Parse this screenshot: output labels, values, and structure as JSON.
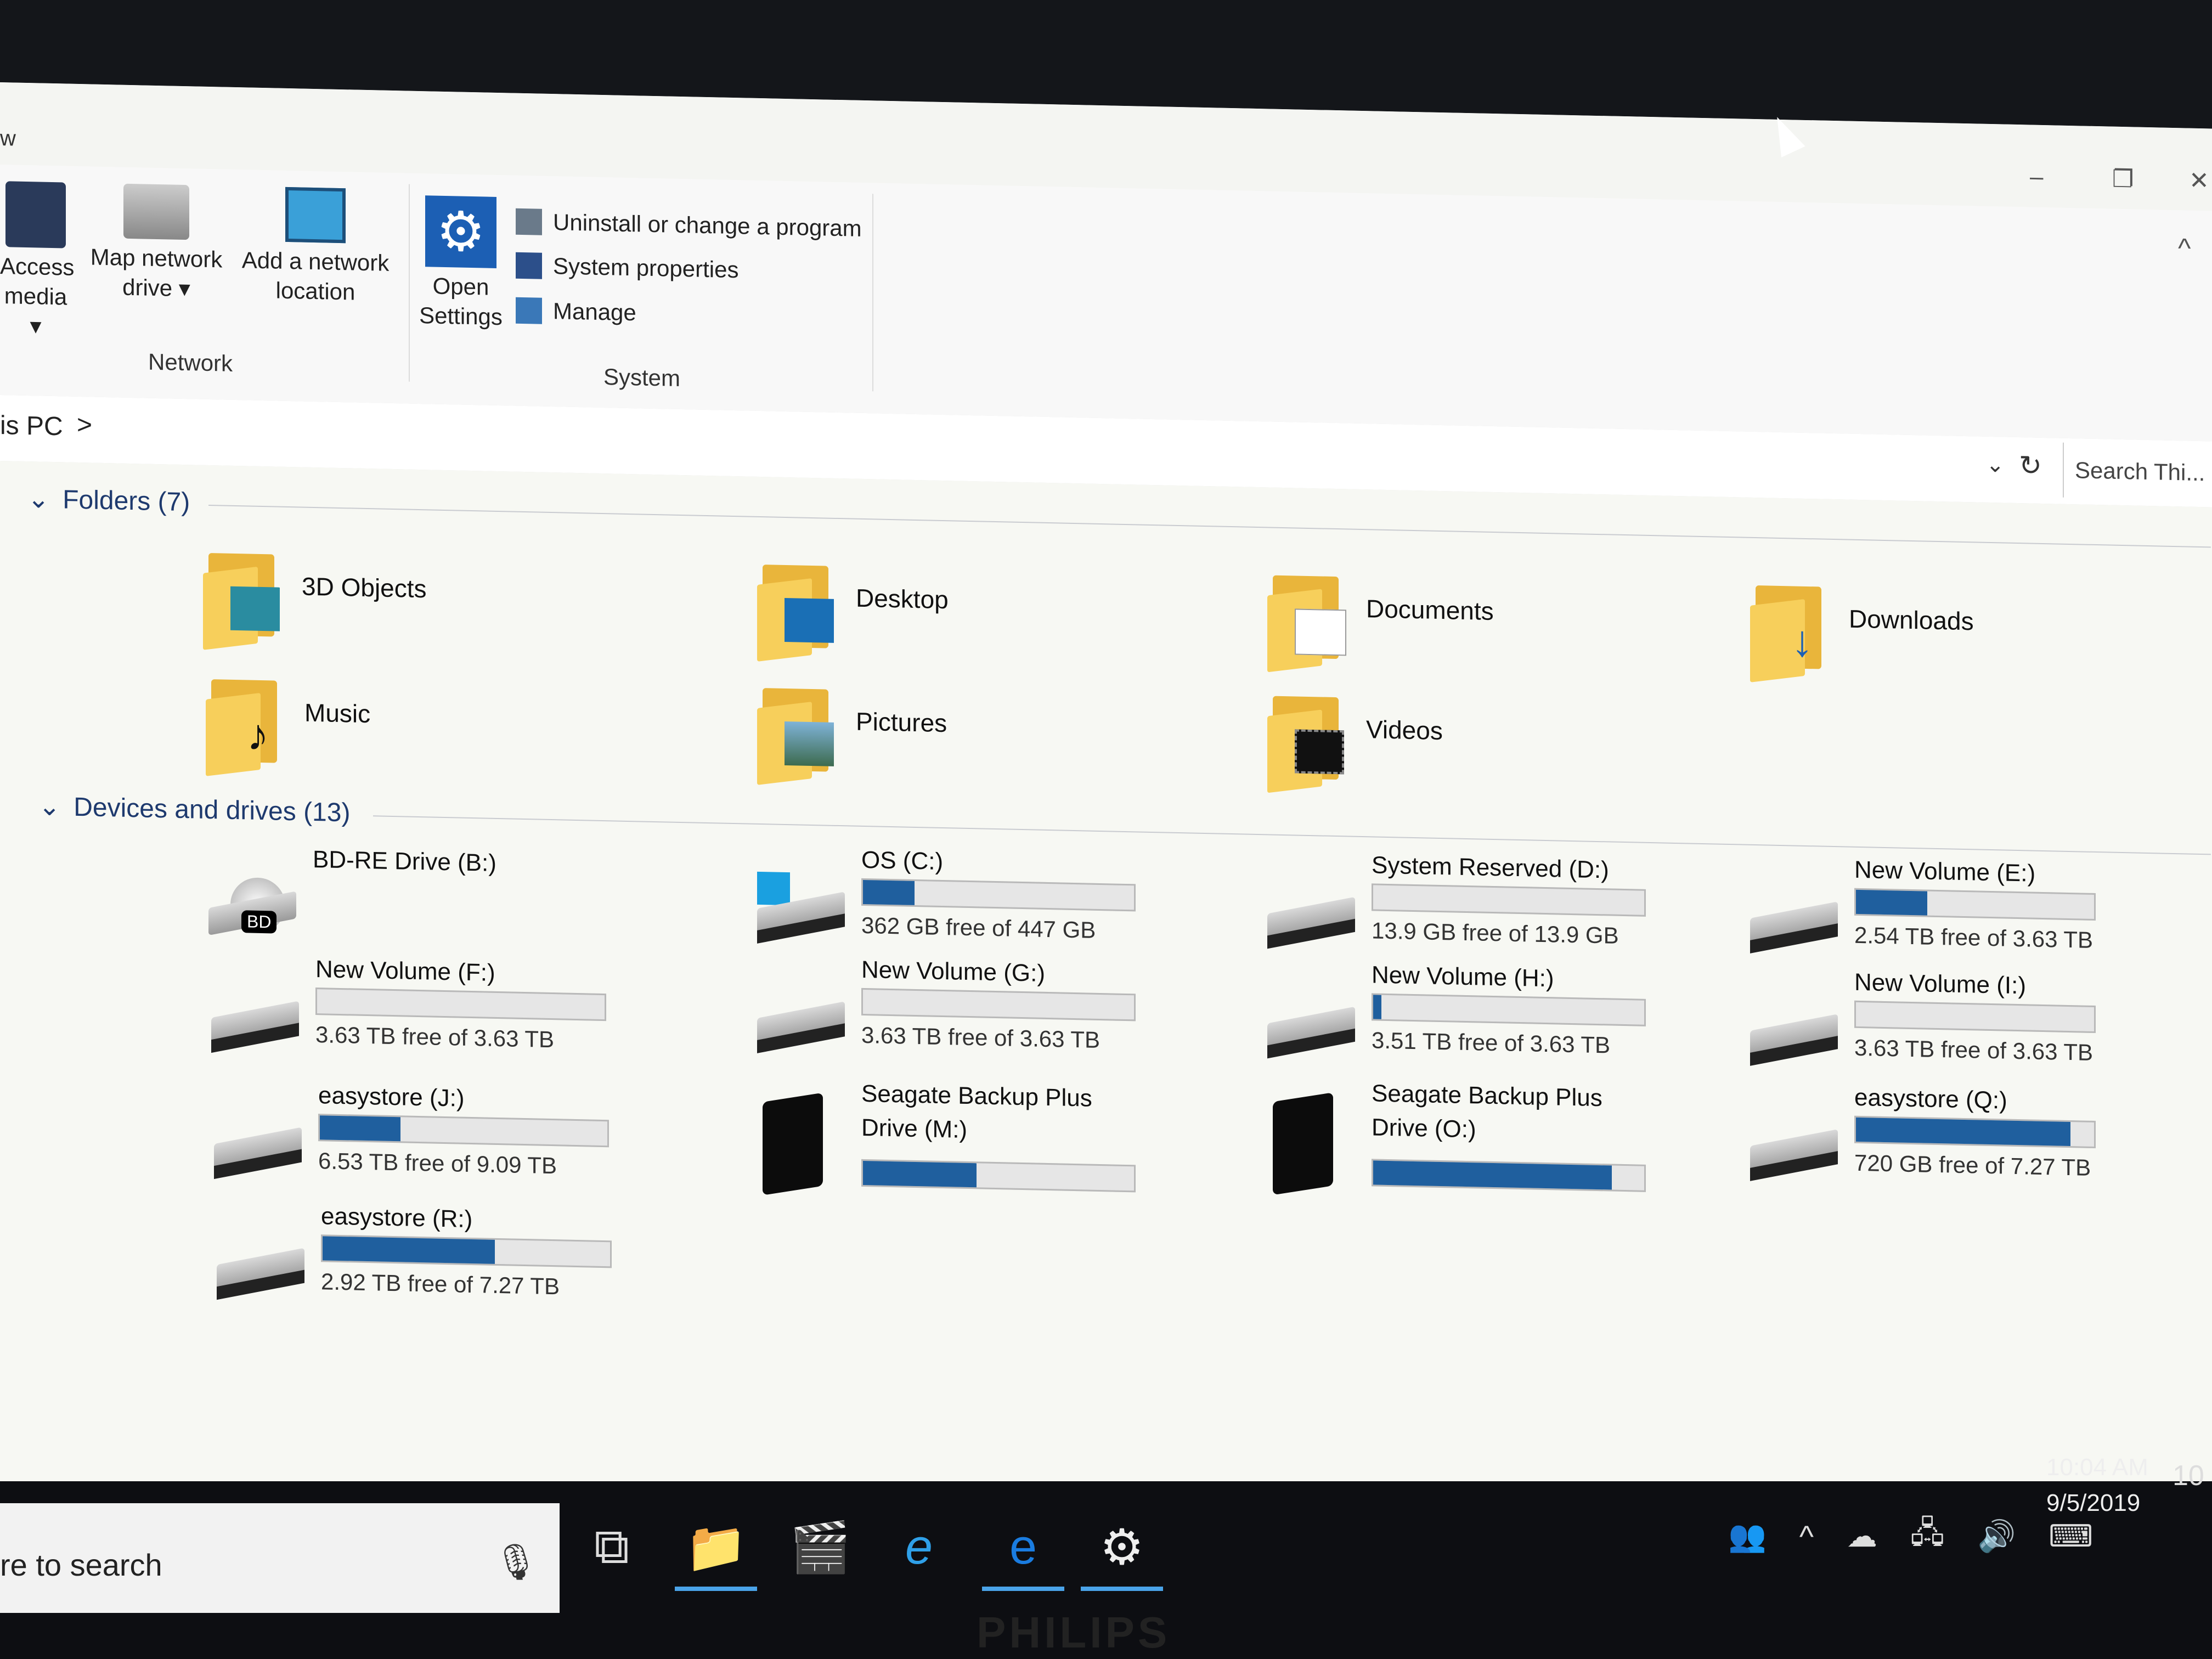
{
  "window": {
    "title_fragment": "w",
    "controls": [
      "–",
      "❐",
      "✕"
    ]
  },
  "ribbon": {
    "network_group": {
      "label": "Network",
      "buttons": [
        {
          "line1": "Access",
          "line2": "media ▾",
          "icon": "media-icon"
        },
        {
          "line1": "Map network",
          "line2": "drive ▾",
          "icon": "network-drive-icon"
        },
        {
          "line1": "Add a network",
          "line2": "location",
          "icon": "network-location-icon"
        }
      ]
    },
    "system_group": {
      "label": "System",
      "open_settings": {
        "line1": "Open",
        "line2": "Settings",
        "icon": "gear-icon"
      },
      "items": [
        {
          "label": "Uninstall or change a program",
          "icon": "uninstall-icon"
        },
        {
          "label": "System properties",
          "icon": "system-properties-icon"
        },
        {
          "label": "Manage",
          "icon": "manage-icon"
        }
      ]
    },
    "collapse_icon": "^"
  },
  "address": {
    "crumb": "is PC",
    "chevron": ">",
    "dropdown": "⌄",
    "refresh": "↻",
    "search_placeholder": "Search Thi..."
  },
  "folders": {
    "header": "Folders (7)",
    "items": [
      {
        "name": "3D Objects",
        "icon": "3d-objects-icon"
      },
      {
        "name": "Desktop",
        "icon": "desktop-icon"
      },
      {
        "name": "Documents",
        "icon": "documents-icon"
      },
      {
        "name": "Downloads",
        "icon": "downloads-icon"
      },
      {
        "name": "Music",
        "icon": "music-icon"
      },
      {
        "name": "Pictures",
        "icon": "pictures-icon"
      },
      {
        "name": "Videos",
        "icon": "videos-icon"
      }
    ]
  },
  "drives": {
    "header": "Devices and drives (13)",
    "items": [
      {
        "name": "BD-RE Drive (B:)",
        "free": "",
        "used_fraction": null,
        "type": "optical"
      },
      {
        "name": "OS (C:)",
        "free": "362 GB free of 447 GB",
        "used_fraction": 0.19,
        "type": "os"
      },
      {
        "name": "System Reserved (D:)",
        "free": "13.9 GB free of 13.9 GB",
        "used_fraction": 0.0,
        "type": "hdd"
      },
      {
        "name": "New Volume (E:)",
        "free": "2.54 TB free of 3.63 TB",
        "used_fraction": 0.3,
        "type": "hdd"
      },
      {
        "name": "New Volume (F:)",
        "free": "3.63 TB free of 3.63 TB",
        "used_fraction": 0.0,
        "type": "hdd"
      },
      {
        "name": "New Volume (G:)",
        "free": "3.63 TB free of 3.63 TB",
        "used_fraction": 0.0,
        "type": "hdd"
      },
      {
        "name": "New Volume (H:)",
        "free": "3.51 TB free of 3.63 TB",
        "used_fraction": 0.03,
        "type": "hdd"
      },
      {
        "name": "New Volume (I:)",
        "free": "3.63 TB free of 3.63 TB",
        "used_fraction": 0.0,
        "type": "hdd"
      },
      {
        "name": "easystore (J:)",
        "free": "6.53 TB free of 9.09 TB",
        "used_fraction": 0.28,
        "type": "hdd"
      },
      {
        "name": "Seagate Backup Plus Drive (M:)",
        "free": "",
        "used_fraction": 0.42,
        "type": "external"
      },
      {
        "name": "Seagate Backup Plus Drive (O:)",
        "free": "",
        "used_fraction": 0.88,
        "type": "external"
      },
      {
        "name": "easystore (Q:)",
        "free": "720 GB free of 7.27 TB",
        "used_fraction": 0.9,
        "type": "hdd"
      },
      {
        "name": "easystore (R:)",
        "free": "2.92 TB free of 7.27 TB",
        "used_fraction": 0.6,
        "type": "hdd"
      }
    ]
  },
  "taskbar": {
    "search_text": "re to search",
    "mic_icon": "🎙",
    "apps": [
      {
        "name": "task-view",
        "glyph": "⧉"
      },
      {
        "name": "file-explorer",
        "glyph": "📁"
      },
      {
        "name": "media-player",
        "glyph": "🎬"
      },
      {
        "name": "internet-explorer",
        "glyph": "e"
      },
      {
        "name": "edge",
        "glyph": "e"
      },
      {
        "name": "settings",
        "glyph": "⚙"
      }
    ],
    "tray": [
      "👥",
      "^",
      "☁",
      "🖧",
      "🔊",
      "⌨"
    ],
    "time": "10:04 AM",
    "date": "9/5/2019",
    "notifications": "10"
  },
  "monitor_brand": "PHILIPS",
  "colors": {
    "accent": "#1f5f9e",
    "folder": "#f7cf5b"
  }
}
